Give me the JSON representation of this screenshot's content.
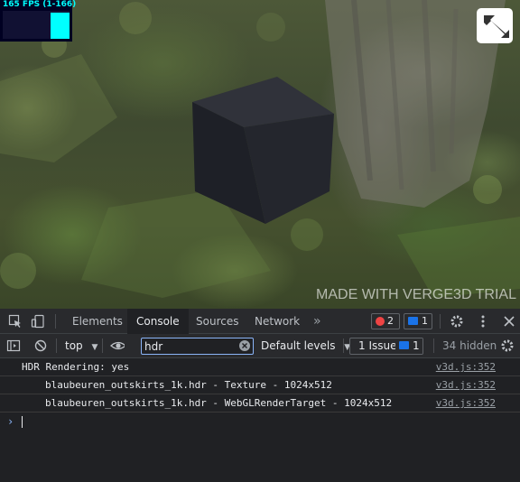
{
  "viewport": {
    "fps_label": "165 FPS (1-166)",
    "fps_bars": [
      0,
      0,
      0,
      0,
      0,
      0,
      0,
      0,
      0,
      0,
      0,
      0,
      0,
      0,
      0,
      0,
      0,
      0,
      0,
      0,
      0,
      0,
      0,
      0,
      0,
      0,
      0,
      0,
      0,
      0,
      0,
      0,
      0,
      0,
      0,
      0,
      0,
      0,
      0,
      0,
      0,
      0,
      0,
      0,
      0,
      0,
      0,
      0,
      0,
      0,
      0,
      0,
      0,
      0.95,
      0.95,
      0.95,
      0.95,
      0.95,
      0.95,
      0.95,
      0.95,
      0.95,
      0.95,
      0.95,
      0.95,
      0.95,
      0.95,
      0.95,
      0.95,
      0.95,
      0.95,
      0.95,
      0.95,
      0.95
    ],
    "watermark": "MADE WITH VERGE3D TRIAL"
  },
  "devtools": {
    "tabs": [
      {
        "label": "Elements",
        "active": false
      },
      {
        "label": "Console",
        "active": true
      },
      {
        "label": "Sources",
        "active": false
      },
      {
        "label": "Network",
        "active": false
      }
    ],
    "more_tabs": "»",
    "error_count": "2",
    "message_count": "1",
    "toolbar": {
      "context": "top",
      "filter_value": "hdr",
      "levels": "Default levels",
      "issues_label": "1 Issue:",
      "issues_count": "1",
      "hidden": "34 hidden"
    },
    "messages": [
      {
        "text": "HDR Rendering: yes",
        "source": "v3d.js:352",
        "indent": false
      },
      {
        "text": "blaubeuren_outskirts_1k.hdr - Texture - 1024x512",
        "source": "v3d.js:352",
        "indent": true
      },
      {
        "text": "blaubeuren_outskirts_1k.hdr - WebGLRenderTarget - 1024x512",
        "source": "v3d.js:352",
        "indent": true
      }
    ],
    "prompt": "›"
  },
  "colors": {
    "accent": "#8ab4f8",
    "error": "#ee4444",
    "message_badge": "#1a73e8",
    "fps": "#00ffff"
  }
}
